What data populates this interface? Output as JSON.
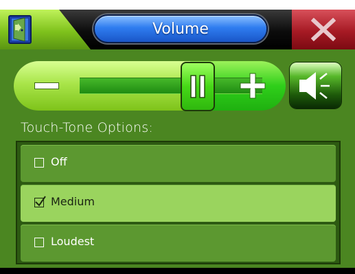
{
  "window": {
    "title": "Volume",
    "app_icon": "door-exit-icon",
    "close_icon": "close-x-icon"
  },
  "volume": {
    "level": 0.65,
    "decrease_icon": "minus-icon",
    "increase_icon": "plus-icon",
    "thumb_icon": "pause-bars-icon",
    "mute_icon": "speaker-icon"
  },
  "touch_tone": {
    "label": "Touch-Tone Options:",
    "options": [
      {
        "label": "Off",
        "checked": false
      },
      {
        "label": "Medium",
        "checked": true
      },
      {
        "label": "Loudest",
        "checked": false
      }
    ]
  },
  "colors": {
    "body_bg": "#4b8621",
    "title_pill": "#2f7df0",
    "close_red": "#a61a24",
    "selected_option": "#9ad45e"
  }
}
